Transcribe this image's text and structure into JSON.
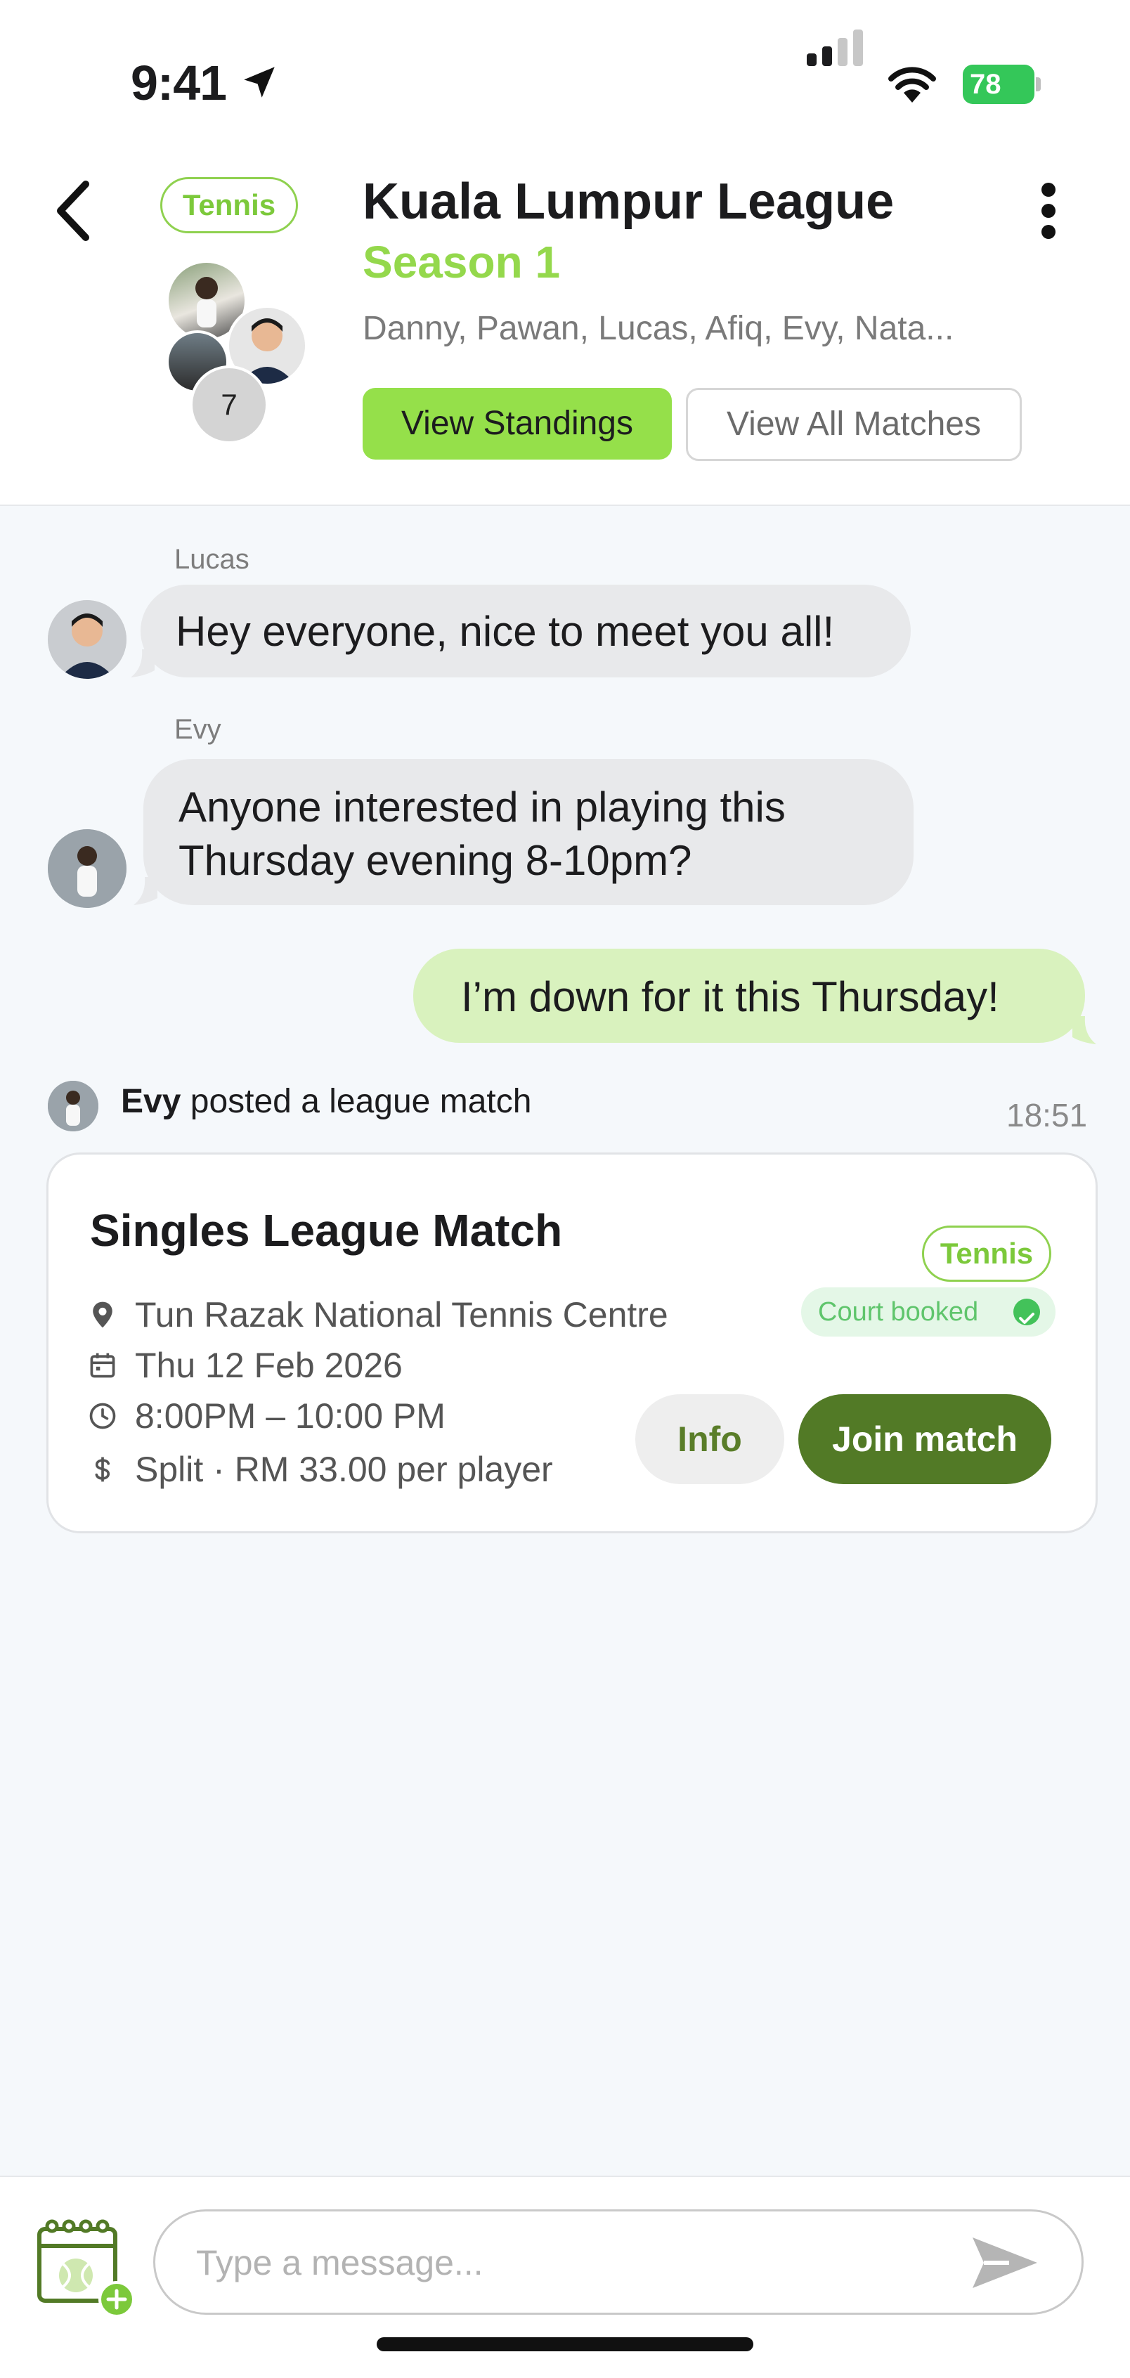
{
  "status_bar": {
    "time": "9:41",
    "battery_percent": "78",
    "location_icon": "location-arrow-icon",
    "signal_icon": "cellular-signal-icon",
    "wifi_icon": "wifi-icon",
    "battery_icon": "battery-charging-icon"
  },
  "header": {
    "sport_tag": "Tennis",
    "title": "Kuala Lumpur League",
    "season": "Season 1",
    "members": "Danny, Pawan, Lucas, Afiq, Evy, Nata...",
    "member_extra_count": "7",
    "view_standings_label": "View Standings",
    "view_all_matches_label": "View All Matches",
    "accent_color": "#95e04a"
  },
  "messages": [
    {
      "sender": "Lucas",
      "text": "Hey everyone, nice to meet you all!"
    },
    {
      "sender": "Evy",
      "text_line1": "Anyone interested in playing this",
      "text_line2": "Thursday evening 8-10pm?"
    },
    {
      "sender": "me",
      "text": "I’m down for it this Thursday!"
    }
  ],
  "post_event": {
    "actor": "Evy",
    "action": " posted a league match",
    "time": "18:51"
  },
  "match_card": {
    "title": "Singles League Match",
    "sport_tag": "Tennis",
    "court_status": "Court booked",
    "venue": "Tun Razak National Tennis Centre",
    "date": "Thu 12 Feb 2026",
    "time": "8:00PM – 10:00 PM",
    "price": "Split · RM 33.00 per player",
    "info_label": "Info",
    "join_label": "Join match",
    "join_color": "#527a26"
  },
  "composer": {
    "placeholder": "Type a message..."
  }
}
